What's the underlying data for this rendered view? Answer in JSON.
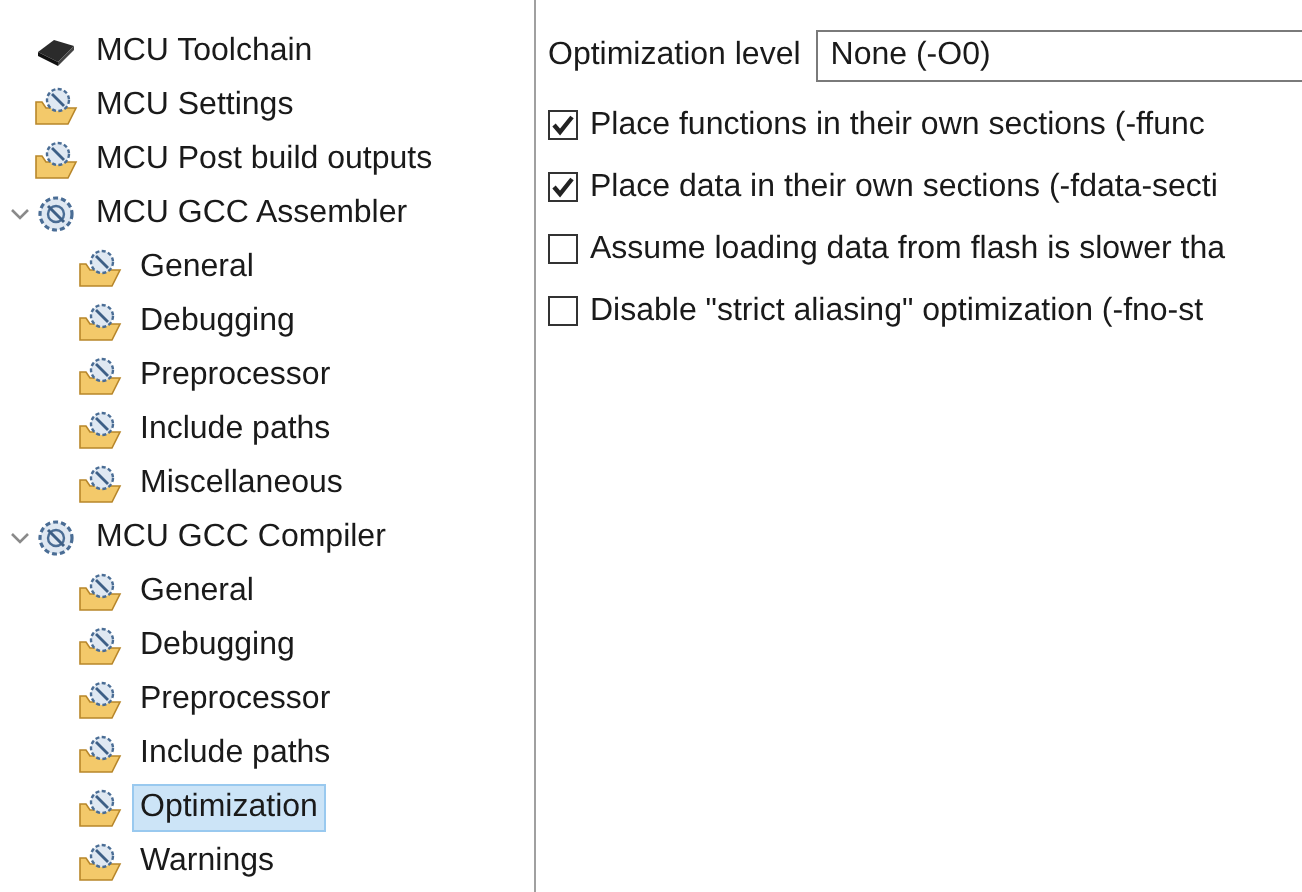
{
  "tree": [
    {
      "label": "MCU Toolchain",
      "kind": "chip",
      "selected": false
    },
    {
      "label": "MCU Settings",
      "kind": "folder",
      "selected": false
    },
    {
      "label": "MCU Post build outputs",
      "kind": "folder",
      "selected": false
    },
    {
      "label": "MCU GCC Assembler",
      "kind": "tool",
      "selected": false,
      "expanded": true,
      "children": [
        {
          "label": "General",
          "kind": "folder",
          "selected": false
        },
        {
          "label": "Debugging",
          "kind": "folder",
          "selected": false
        },
        {
          "label": "Preprocessor",
          "kind": "folder",
          "selected": false
        },
        {
          "label": "Include paths",
          "kind": "folder",
          "selected": false
        },
        {
          "label": "Miscellaneous",
          "kind": "folder",
          "selected": false
        }
      ]
    },
    {
      "label": "MCU GCC Compiler",
      "kind": "tool",
      "selected": false,
      "expanded": true,
      "children": [
        {
          "label": "General",
          "kind": "folder",
          "selected": false
        },
        {
          "label": "Debugging",
          "kind": "folder",
          "selected": false
        },
        {
          "label": "Preprocessor",
          "kind": "folder",
          "selected": false
        },
        {
          "label": "Include paths",
          "kind": "folder",
          "selected": false
        },
        {
          "label": "Optimization",
          "kind": "folder",
          "selected": true
        },
        {
          "label": "Warnings",
          "kind": "folder",
          "selected": false
        }
      ]
    }
  ],
  "optimization_level": {
    "label": "Optimization level",
    "value": "None (-O0)"
  },
  "options": [
    {
      "label": "Place functions in their own sections (-ffunc",
      "checked": true
    },
    {
      "label": "Place data in their own sections (-fdata-secti",
      "checked": true
    },
    {
      "label": "Assume loading data from flash is slower tha",
      "checked": false
    },
    {
      "label": "Disable \"strict aliasing\" optimization (-fno-st",
      "checked": false
    }
  ]
}
